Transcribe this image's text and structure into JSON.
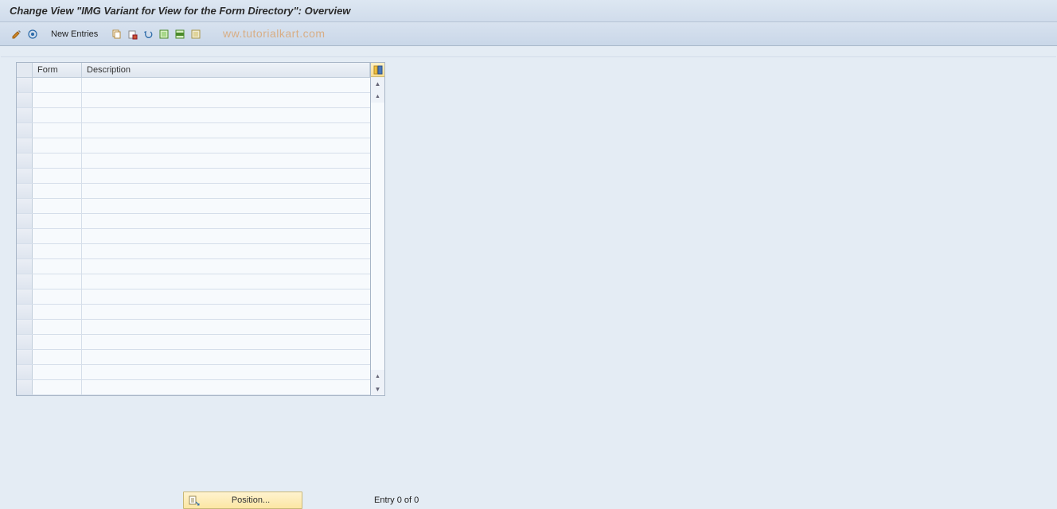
{
  "title": "Change View \"IMG Variant for View for the Form Directory\": Overview",
  "toolbar": {
    "new_entries": "New Entries",
    "icons": {
      "display_change": "display-change",
      "other_view": "other-view",
      "copy": "copy",
      "delete": "delete",
      "undo": "undo",
      "select_all": "select-all",
      "select_block": "select-block",
      "deselect": "deselect"
    }
  },
  "watermark": "ww.tutorialkart.com",
  "table": {
    "columns": {
      "form": "Form",
      "description": "Description"
    },
    "row_count": 21
  },
  "footer": {
    "position_label": "Position...",
    "entry_text": "Entry 0 of 0"
  }
}
